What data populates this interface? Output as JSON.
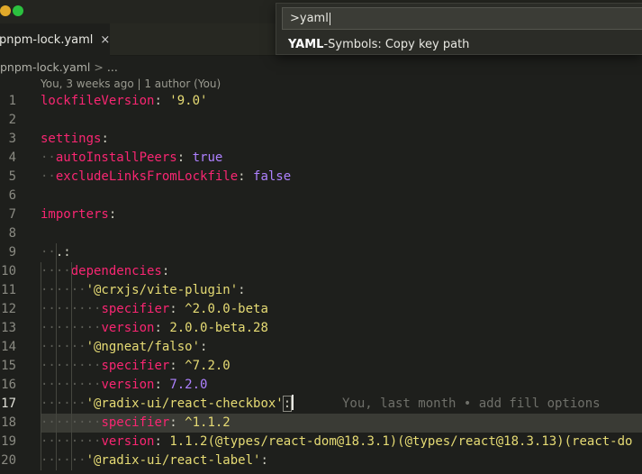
{
  "window": {
    "traffic_lights": [
      "yellow",
      "green"
    ]
  },
  "tab": {
    "label": "pnpm-lock.yaml",
    "close_icon": "×"
  },
  "breadcrumb": {
    "file": "pnpm-lock.yaml",
    "separator": ">",
    "more": "..."
  },
  "codelens": "You, 3 weeks ago | 1 author (You)",
  "palette": {
    "input_value": ">yaml",
    "result_match": "YAML",
    "result_rest": "-Symbols: Copy key path"
  },
  "editor": {
    "active_line": "17",
    "blame_text": "You, last month • add fill options",
    "lines": [
      {
        "n": "1",
        "t1": "lockfileVersion",
        "t2": ":",
        "t3": " '9.0'"
      },
      {
        "n": "2"
      },
      {
        "n": "3",
        "t1": "settings",
        "t2": ":"
      },
      {
        "n": "4",
        "ind": "··",
        "t1": "autoInstallPeers",
        "t2": ":",
        "t3": " true"
      },
      {
        "n": "5",
        "ind": "··",
        "t1": "excludeLinksFromLockfile",
        "t2": ":",
        "t3": " false"
      },
      {
        "n": "6"
      },
      {
        "n": "7",
        "t1": "importers",
        "t2": ":"
      },
      {
        "n": "8"
      },
      {
        "n": "9",
        "ind": "··",
        "t1": ".",
        "t2": ":"
      },
      {
        "n": "10",
        "ind": "····",
        "t1": "dependencies",
        "t2": ":"
      },
      {
        "n": "11",
        "ind": "······",
        "t1": "'@crxjs/vite-plugin'",
        "t2": ":"
      },
      {
        "n": "12",
        "ind": "········",
        "t1": "specifier",
        "t2": ":",
        "t3": " ^2.0.0-beta"
      },
      {
        "n": "13",
        "ind": "········",
        "t1": "version",
        "t2": ":",
        "t3": " 2.0.0-beta.28"
      },
      {
        "n": "14",
        "ind": "······",
        "t1": "'@ngneat/falso'",
        "t2": ":"
      },
      {
        "n": "15",
        "ind": "········",
        "t1": "specifier",
        "t2": ":",
        "t3": " ^7.2.0"
      },
      {
        "n": "16",
        "ind": "········",
        "t1": "version",
        "t2": ":",
        "t3": " 7.2.0"
      },
      {
        "n": "17",
        "ind": "······",
        "t1": "'@radix-ui/react-checkbox'",
        "t2": ":"
      },
      {
        "n": "18",
        "ind": "········",
        "t1": "specifier",
        "t2": ":",
        "t3": " ^1.1.2"
      },
      {
        "n": "19",
        "ind": "········",
        "t1": "version",
        "t2": ":",
        "t3": " 1.1.2(@types/react-dom@18.3.1)(@types/react@18.3.13)(react-do"
      },
      {
        "n": "20",
        "ind": "······",
        "t1": "'@radix-ui/react-label'",
        "t2": ":"
      }
    ]
  }
}
